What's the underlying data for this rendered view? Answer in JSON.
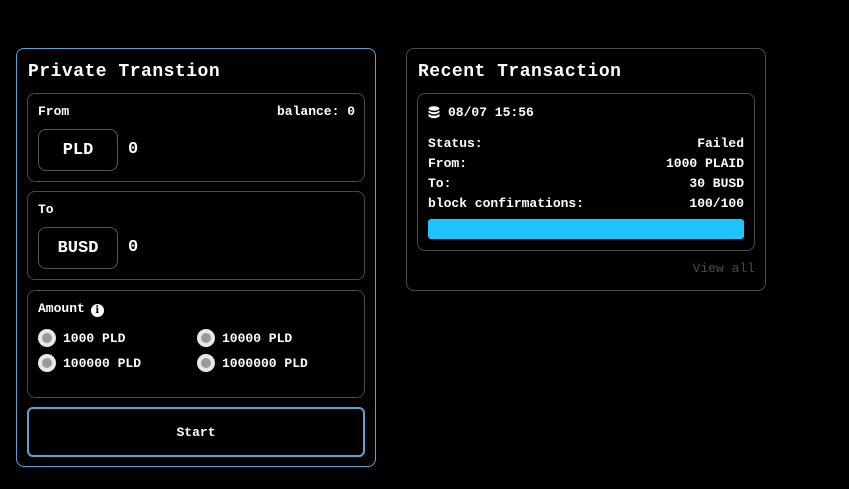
{
  "private": {
    "title": "Private Transtion",
    "from": {
      "label": "From",
      "balance": "balance: 0",
      "token": "PLD",
      "amount": "0"
    },
    "to": {
      "label": "To",
      "token": "BUSD",
      "amount": "0"
    },
    "amount": {
      "label": "Amount",
      "info_icon": "info-icon",
      "options": [
        "1000 PLD",
        "10000 PLD",
        "100000 PLD",
        "1000000 PLD"
      ]
    },
    "start_label": "Start"
  },
  "recent": {
    "title": "Recent Transaction",
    "tx": {
      "icon": "database-icon",
      "timestamp": "08/07 15:56",
      "status_label": "Status:",
      "status_value": "Failed",
      "from_label": "From:",
      "from_value": "1000 PLAID",
      "to_label": "To:",
      "to_value": "30 BUSD",
      "confirm_label": "block confirmations:",
      "confirm_value": "100/100",
      "progress": 1.0
    },
    "view_all": "View all"
  },
  "colors": {
    "accent_border": "#5da3d6",
    "progress_fill": "#1fc3ff",
    "muted_border": "#4a4a4a"
  }
}
